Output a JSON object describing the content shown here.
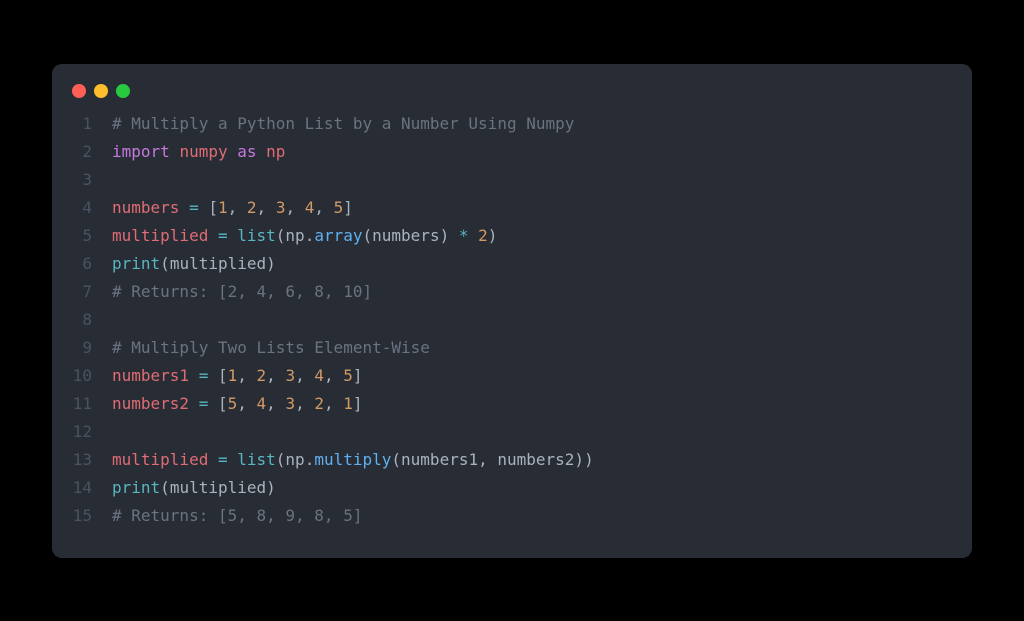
{
  "window": {
    "traffic_lights": [
      "red",
      "yellow",
      "green"
    ]
  },
  "colors": {
    "background": "#282c34",
    "comment": "#6b7280",
    "keyword": "#c678dd",
    "module": "#e06c75",
    "operator": "#56b6c2",
    "number": "#d19a66",
    "function": "#61afef",
    "text": "#abb2bf"
  },
  "code": {
    "language": "python",
    "lines": [
      {
        "num": "1",
        "tokens": [
          {
            "t": "# Multiply a Python List by a Number Using Numpy",
            "c": "comment"
          }
        ]
      },
      {
        "num": "2",
        "tokens": [
          {
            "t": "import",
            "c": "keyword"
          },
          {
            "t": " ",
            "c": "plain"
          },
          {
            "t": "numpy",
            "c": "module"
          },
          {
            "t": " ",
            "c": "plain"
          },
          {
            "t": "as",
            "c": "keyword"
          },
          {
            "t": " ",
            "c": "plain"
          },
          {
            "t": "np",
            "c": "module"
          }
        ]
      },
      {
        "num": "3",
        "tokens": []
      },
      {
        "num": "4",
        "tokens": [
          {
            "t": "numbers",
            "c": "variable"
          },
          {
            "t": " ",
            "c": "plain"
          },
          {
            "t": "=",
            "c": "operator"
          },
          {
            "t": " ",
            "c": "plain"
          },
          {
            "t": "[",
            "c": "bracket"
          },
          {
            "t": "1",
            "c": "number"
          },
          {
            "t": ", ",
            "c": "punct"
          },
          {
            "t": "2",
            "c": "number"
          },
          {
            "t": ", ",
            "c": "punct"
          },
          {
            "t": "3",
            "c": "number"
          },
          {
            "t": ", ",
            "c": "punct"
          },
          {
            "t": "4",
            "c": "number"
          },
          {
            "t": ", ",
            "c": "punct"
          },
          {
            "t": "5",
            "c": "number"
          },
          {
            "t": "]",
            "c": "bracket"
          }
        ]
      },
      {
        "num": "5",
        "tokens": [
          {
            "t": "multiplied",
            "c": "variable"
          },
          {
            "t": " ",
            "c": "plain"
          },
          {
            "t": "=",
            "c": "operator"
          },
          {
            "t": " ",
            "c": "plain"
          },
          {
            "t": "list",
            "c": "builtin"
          },
          {
            "t": "(",
            "c": "bracket"
          },
          {
            "t": "np",
            "c": "plain"
          },
          {
            "t": ".",
            "c": "punct"
          },
          {
            "t": "array",
            "c": "func"
          },
          {
            "t": "(",
            "c": "bracket"
          },
          {
            "t": "numbers",
            "c": "plain"
          },
          {
            "t": ")",
            "c": "bracket"
          },
          {
            "t": " ",
            "c": "plain"
          },
          {
            "t": "*",
            "c": "operator"
          },
          {
            "t": " ",
            "c": "plain"
          },
          {
            "t": "2",
            "c": "number"
          },
          {
            "t": ")",
            "c": "bracket"
          }
        ]
      },
      {
        "num": "6",
        "tokens": [
          {
            "t": "print",
            "c": "builtin"
          },
          {
            "t": "(",
            "c": "bracket"
          },
          {
            "t": "multiplied",
            "c": "plain"
          },
          {
            "t": ")",
            "c": "bracket"
          }
        ]
      },
      {
        "num": "7",
        "tokens": [
          {
            "t": "# Returns: [2, 4, 6, 8, 10]",
            "c": "comment"
          }
        ]
      },
      {
        "num": "8",
        "tokens": []
      },
      {
        "num": "9",
        "tokens": [
          {
            "t": "# Multiply Two Lists Element-Wise",
            "c": "comment"
          }
        ]
      },
      {
        "num": "10",
        "tokens": [
          {
            "t": "numbers1",
            "c": "variable"
          },
          {
            "t": " ",
            "c": "plain"
          },
          {
            "t": "=",
            "c": "operator"
          },
          {
            "t": " ",
            "c": "plain"
          },
          {
            "t": "[",
            "c": "bracket"
          },
          {
            "t": "1",
            "c": "number"
          },
          {
            "t": ", ",
            "c": "punct"
          },
          {
            "t": "2",
            "c": "number"
          },
          {
            "t": ", ",
            "c": "punct"
          },
          {
            "t": "3",
            "c": "number"
          },
          {
            "t": ", ",
            "c": "punct"
          },
          {
            "t": "4",
            "c": "number"
          },
          {
            "t": ", ",
            "c": "punct"
          },
          {
            "t": "5",
            "c": "number"
          },
          {
            "t": "]",
            "c": "bracket"
          }
        ]
      },
      {
        "num": "11",
        "tokens": [
          {
            "t": "numbers2",
            "c": "variable"
          },
          {
            "t": " ",
            "c": "plain"
          },
          {
            "t": "=",
            "c": "operator"
          },
          {
            "t": " ",
            "c": "plain"
          },
          {
            "t": "[",
            "c": "bracket"
          },
          {
            "t": "5",
            "c": "number"
          },
          {
            "t": ", ",
            "c": "punct"
          },
          {
            "t": "4",
            "c": "number"
          },
          {
            "t": ", ",
            "c": "punct"
          },
          {
            "t": "3",
            "c": "number"
          },
          {
            "t": ", ",
            "c": "punct"
          },
          {
            "t": "2",
            "c": "number"
          },
          {
            "t": ", ",
            "c": "punct"
          },
          {
            "t": "1",
            "c": "number"
          },
          {
            "t": "]",
            "c": "bracket"
          }
        ]
      },
      {
        "num": "12",
        "tokens": []
      },
      {
        "num": "13",
        "tokens": [
          {
            "t": "multiplied",
            "c": "variable"
          },
          {
            "t": " ",
            "c": "plain"
          },
          {
            "t": "=",
            "c": "operator"
          },
          {
            "t": " ",
            "c": "plain"
          },
          {
            "t": "list",
            "c": "builtin"
          },
          {
            "t": "(",
            "c": "bracket"
          },
          {
            "t": "np",
            "c": "plain"
          },
          {
            "t": ".",
            "c": "punct"
          },
          {
            "t": "multiply",
            "c": "func"
          },
          {
            "t": "(",
            "c": "bracket"
          },
          {
            "t": "numbers1",
            "c": "plain"
          },
          {
            "t": ", ",
            "c": "punct"
          },
          {
            "t": "numbers2",
            "c": "plain"
          },
          {
            "t": ")",
            "c": "bracket"
          },
          {
            "t": ")",
            "c": "bracket"
          }
        ]
      },
      {
        "num": "14",
        "tokens": [
          {
            "t": "print",
            "c": "builtin"
          },
          {
            "t": "(",
            "c": "bracket"
          },
          {
            "t": "multiplied",
            "c": "plain"
          },
          {
            "t": ")",
            "c": "bracket"
          }
        ]
      },
      {
        "num": "15",
        "tokens": [
          {
            "t": "# Returns: [5, 8, 9, 8, 5]",
            "c": "comment"
          }
        ]
      }
    ]
  }
}
